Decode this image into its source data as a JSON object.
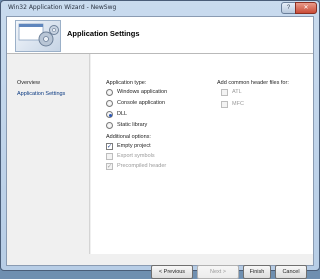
{
  "window": {
    "title": "Win32 Application Wizard - NewSwg",
    "help_glyph": "?",
    "close_glyph": "✕"
  },
  "banner": {
    "title": "Application Settings"
  },
  "nav": {
    "items": [
      {
        "label": "Overview"
      },
      {
        "label": "Application Settings"
      }
    ]
  },
  "app_type": {
    "heading": "Application type:",
    "options": [
      {
        "label": "Windows application",
        "selected": false
      },
      {
        "label": "Console application",
        "selected": false
      },
      {
        "label": "DLL",
        "selected": true
      },
      {
        "label": "Static library",
        "selected": false
      }
    ]
  },
  "additional": {
    "heading": "Additional options:",
    "options": [
      {
        "label": "Empty project",
        "checked": true,
        "enabled": true
      },
      {
        "label": "Export symbols",
        "checked": false,
        "enabled": false
      },
      {
        "label": "Precompiled header",
        "checked": true,
        "enabled": false
      }
    ]
  },
  "headers": {
    "heading": "Add common header files for:",
    "options": [
      {
        "label": "ATL",
        "checked": false,
        "enabled": false
      },
      {
        "label": "MFC",
        "checked": false,
        "enabled": false
      }
    ]
  },
  "buttons": {
    "previous": "< Previous",
    "next": "Next >",
    "finish": "Finish",
    "cancel": "Cancel"
  },
  "check_glyph": "✓"
}
